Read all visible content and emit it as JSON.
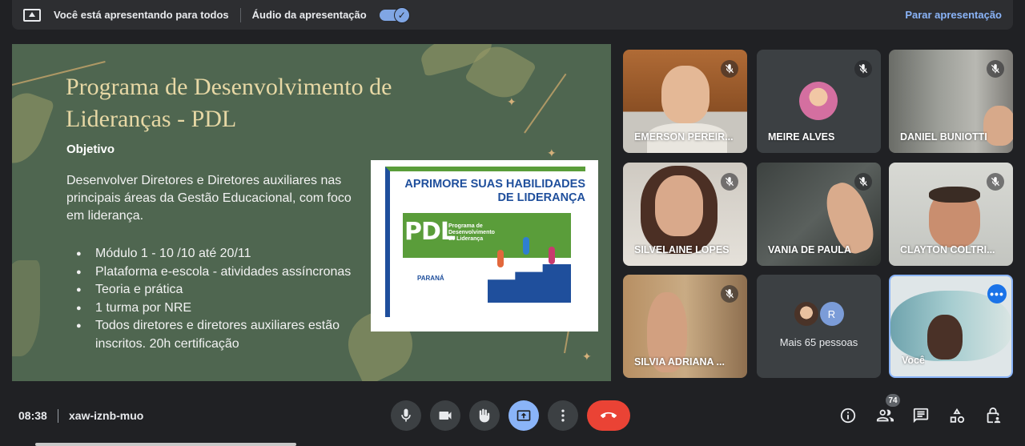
{
  "banner": {
    "presenting_text": "Você está apresentando para todos",
    "audio_label": "Áudio da apresentação",
    "stop_label": "Parar apresentação"
  },
  "slide": {
    "title": "Programa de Desenvolvimento de Lideranças - PDL",
    "subtitle": "Objetivo",
    "description": "Desenvolver Diretores e Diretores auxiliares nas principais áreas da Gestão Educacional, com foco em liderança.",
    "bullets": [
      "Módulo 1  - 10 /10  até 20/11",
      "Plataforma e-escola - atividades assíncronas",
      "Teoria e prática",
      "1 turma por NRE",
      "Todos diretores e diretores auxiliares estão inscritos.  20h certificação"
    ],
    "image": {
      "heading": "APRIMORE SUAS HABILIDADES DE LIDERANÇA",
      "logo": "PDL",
      "logo_sub": "Programa de Desenvolvimento de Liderança",
      "state": "PARANÁ"
    }
  },
  "participants": [
    {
      "name": "EMERSON PEREIR..."
    },
    {
      "name": "MEIRE ALVES"
    },
    {
      "name": "DANIEL BUNIOTTI"
    },
    {
      "name": "SILVELAINE LOPES"
    },
    {
      "name": "VANIA DE PAULA"
    },
    {
      "name": "CLAYTON COLTRI..."
    },
    {
      "name": "SILVIA ADRIANA ..."
    },
    {
      "name": "Mais 65 pessoas",
      "avatar_letter": "R"
    },
    {
      "name": "Você"
    }
  ],
  "bottom": {
    "time": "08:38",
    "meeting_code": "xaw-iznb-muo",
    "people_count": "74"
  },
  "colors": {
    "accent": "#8ab4f8",
    "end_call": "#ea4335",
    "slide_bg": "#4f6650"
  }
}
